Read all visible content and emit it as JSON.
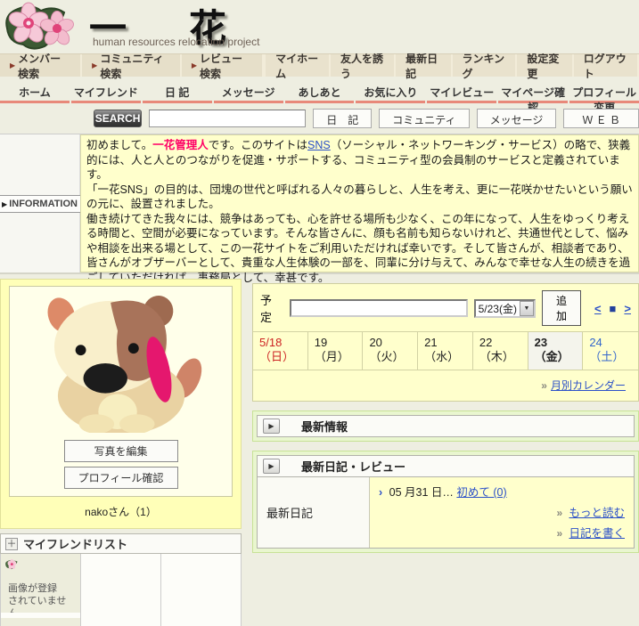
{
  "icons": {
    "arrow_right": "▶",
    "dropdown": "▼",
    "plus": "＋",
    "link_arrow": "»",
    "entry_arrow": "›"
  },
  "header": {
    "title": "一　花",
    "subtitle": "human resources relocation project"
  },
  "nav_primary": {
    "left": [
      "メンバー検索",
      "コミュニティ検索",
      "レビュー検索"
    ],
    "right": [
      "マイホーム",
      "友人を誘う",
      "最新日記",
      "ランキング",
      "設定変更",
      "ログアウト"
    ]
  },
  "nav_tabs": [
    "ホーム",
    "マイフレンド",
    "日 記",
    "メッセージ",
    "あしあと",
    "お気に入り",
    "マイレビュー",
    "マイページ確認",
    "プロフィール変更"
  ],
  "search": {
    "button": "SEARCH",
    "input_value": "",
    "scopes": [
      "日　記",
      "コミュニティ",
      "メッセージ",
      "Ｗ Ｅ Ｂ"
    ]
  },
  "information": {
    "label": "INFORMATION",
    "p1_pre": "初めまして。",
    "p1_admin": "一花管理人",
    "p1_mid": "です。このサイトは",
    "p1_link": "SNS",
    "p1_post": "（ソーシャル・ネットワーキング・サービス）の略で、狭義的には、人と人とのつながりを促進・サポートする、コミュニティ型の会員制のサービスと定義されています。",
    "p2": "「一花SNS」の目的は、団塊の世代と呼ばれる人々の暮らしと、人生を考え、更に一花咲かせたいという願いの元に、設置されました。",
    "p3": "働き続けてきた我々には、競争はあっても、心を許せる場所も少なく、この年になって、人生をゆっくり考える時間と、空間が必要になっています。そんな皆さんに、顔も名前も知らないけれど、共通世代として、悩みや相談を出来る場として、この一花サイトをご利用いただければ幸いです。そして皆さんが、相談者であり、皆さんがオブザーバーとして、貴重な人生体験の一部を、同輩に分け与えて、みんなで幸せな人生の続きを過ごしていただければ、事務局として、幸甚です。"
  },
  "profile": {
    "edit_photo_button": "写真を編集",
    "confirm_profile_button": "プロフィール確認",
    "caption": "nakoさん（1）"
  },
  "friends": {
    "title": "マイフレンドリスト",
    "no_image_line1": "画像が登録",
    "no_image_line2": "されていません"
  },
  "schedule": {
    "label": "予定",
    "input_value": "",
    "date_select": "5/23(金)",
    "add_button": "追加",
    "prev": "<",
    "square": "■",
    "next": ">",
    "monthly_link": "月別カレンダー",
    "days": [
      {
        "date": "5/18",
        "dow": "（日）"
      },
      {
        "date": "19",
        "dow": "（月）"
      },
      {
        "date": "20",
        "dow": "（火）"
      },
      {
        "date": "21",
        "dow": "（水）"
      },
      {
        "date": "22",
        "dow": "（木）"
      },
      {
        "date": "23",
        "dow": "（金）"
      },
      {
        "date": "24",
        "dow": "（土）"
      }
    ]
  },
  "latest_info": {
    "title": "最新情報"
  },
  "latest_diary": {
    "title": "最新日記・レビュー",
    "row_label": "最新日記",
    "entry_date": "05 月31 日…",
    "entry_link": "初めて (0)",
    "read_more_link": "もっと読む",
    "write_diary_link": "日記を書く"
  }
}
